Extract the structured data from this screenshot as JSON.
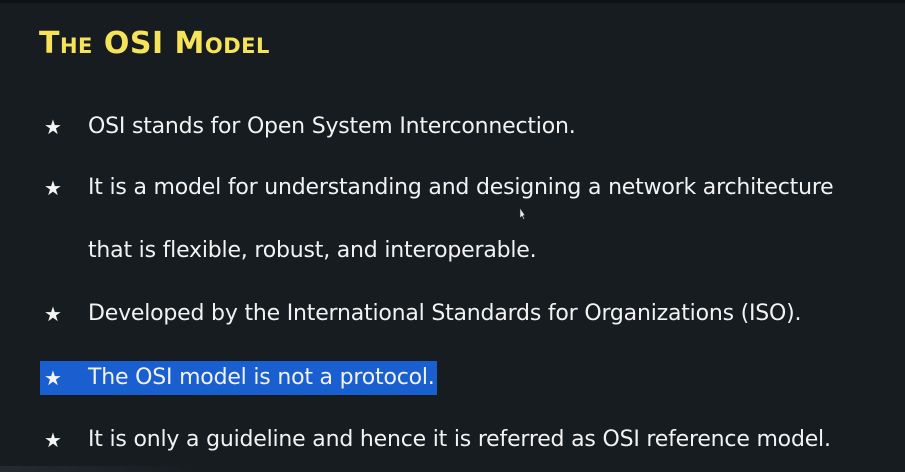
{
  "slide": {
    "title": "The OSI Model",
    "bullets": [
      {
        "star": "★",
        "text": "OSI stands for Open System Interconnection."
      },
      {
        "star": "★",
        "text": "It is a model for understanding and designing a network architecture",
        "continuation": "that is flexible, robust, and interoperable."
      },
      {
        "star": "★",
        "text": "Developed by the International Standards for Organizations (ISO)."
      },
      {
        "star": "★",
        "text": "The OSI model is not a protocol."
      },
      {
        "star": "★",
        "text": "It is only a guideline and hence it is referred as OSI reference model."
      }
    ]
  },
  "colors": {
    "background": "#161c20",
    "title": "#f5e35a",
    "text": "#f2f2f2",
    "selection_highlight": "#1a5fd0"
  },
  "cursor_icon": "mouse-pointer-icon"
}
